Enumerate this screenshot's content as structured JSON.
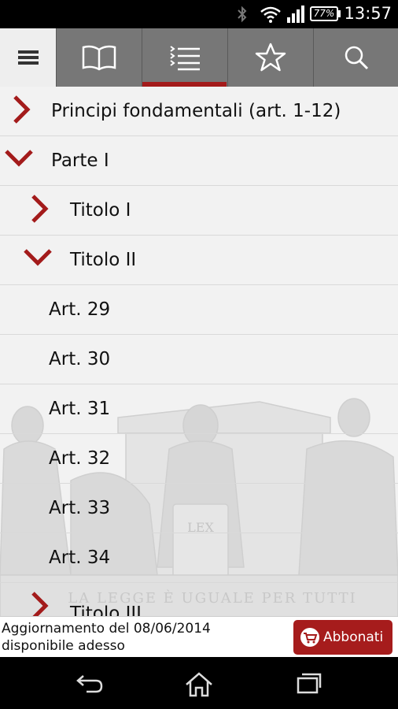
{
  "status_bar": {
    "time": "13:57",
    "battery": "77%",
    "icons": [
      "bluetooth-icon",
      "wifi-icon",
      "signal-icon",
      "battery-icon"
    ]
  },
  "toolbar": {
    "tabs": [
      {
        "icon": "menu-icon",
        "active": false
      },
      {
        "icon": "book-icon",
        "active": false
      },
      {
        "icon": "list-icon",
        "active": true
      },
      {
        "icon": "star-icon",
        "active": false
      },
      {
        "icon": "search-icon",
        "active": false
      }
    ]
  },
  "tree": {
    "items": [
      {
        "label": "Principi fondamentali (art. 1-12)",
        "state": "collapsed"
      },
      {
        "label": "Parte I",
        "state": "expanded"
      },
      {
        "label": "Titolo I",
        "state": "collapsed"
      },
      {
        "label": "Titolo II",
        "state": "expanded"
      },
      {
        "label": "Art. 29"
      },
      {
        "label": "Art. 30"
      },
      {
        "label": "Art. 31"
      },
      {
        "label": "Art. 32"
      },
      {
        "label": "Art. 33"
      },
      {
        "label": "Art. 34"
      },
      {
        "label": "Titolo III",
        "state": "collapsed"
      }
    ]
  },
  "background": {
    "inscription": "LA LEGGE È UGUALE PER TUTTI",
    "tablet_text": "LEX"
  },
  "update_bar": {
    "line1": "Aggiornamento del 08/06/2014",
    "line2": "disponibile adesso",
    "button_label": "Abbonati"
  },
  "colors": {
    "accent": "#a31b1b",
    "toolbar": "#777777",
    "background": "#f2f2f2"
  }
}
